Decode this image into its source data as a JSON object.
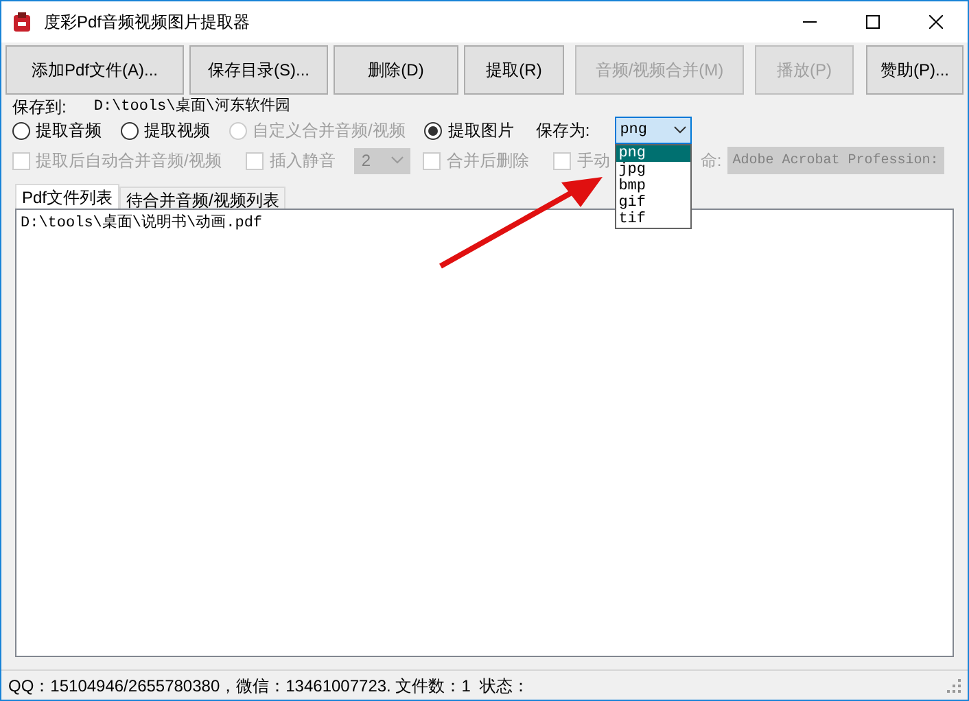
{
  "window": {
    "title": "度彩Pdf音频视频图片提取器"
  },
  "toolbar": [
    {
      "label": "添加Pdf文件(A)...",
      "disabled": false
    },
    {
      "label": "保存目录(S)...",
      "disabled": false
    },
    {
      "label": "删除(D)",
      "disabled": false
    },
    {
      "label": "提取(R)",
      "disabled": false
    },
    {
      "label": "音频/视频合并(M)",
      "disabled": true
    },
    {
      "label": "播放(P)",
      "disabled": true
    },
    {
      "label": "赞助(P)...",
      "disabled": false
    }
  ],
  "save_to": {
    "label": "保存到:",
    "path": "D:\\tools\\桌面\\河东软件园"
  },
  "modes": [
    {
      "label": "提取音频",
      "selected": false,
      "disabled": false
    },
    {
      "label": "提取视频",
      "selected": false,
      "disabled": false
    },
    {
      "label": "自定义合并音频/视频",
      "selected": false,
      "disabled": true
    },
    {
      "label": "提取图片",
      "selected": true,
      "disabled": false
    }
  ],
  "format": {
    "label": "保存为:",
    "value": "png",
    "options": [
      {
        "label": "png",
        "selected": true
      },
      {
        "label": "jpg",
        "selected": false
      },
      {
        "label": "bmp",
        "selected": false
      },
      {
        "label": "gif",
        "selected": false
      },
      {
        "label": "tif",
        "selected": false
      }
    ]
  },
  "options": [
    {
      "label": "提取后自动合并音频/视频",
      "checked": false,
      "disabled": true
    },
    {
      "label": "插入静音",
      "checked": false,
      "disabled": true
    },
    {
      "label": "合并后删除",
      "checked": false,
      "disabled": true
    },
    {
      "label": "手动",
      "checked": false,
      "disabled": true
    }
  ],
  "silence_select": {
    "value": "2"
  },
  "player_label": "命:",
  "player_select": {
    "value": "Adobe Acrobat Profession:"
  },
  "tabs": [
    {
      "label": "Pdf文件列表",
      "selected": true
    },
    {
      "label": "待合并音频/视频列表",
      "selected": false
    }
  ],
  "files": [
    "D:\\tools\\桌面\\说明书\\动画.pdf"
  ],
  "status_bar": "QQ：15104946/2655780380，微信：13461007723. 文件数：1  状态："
}
